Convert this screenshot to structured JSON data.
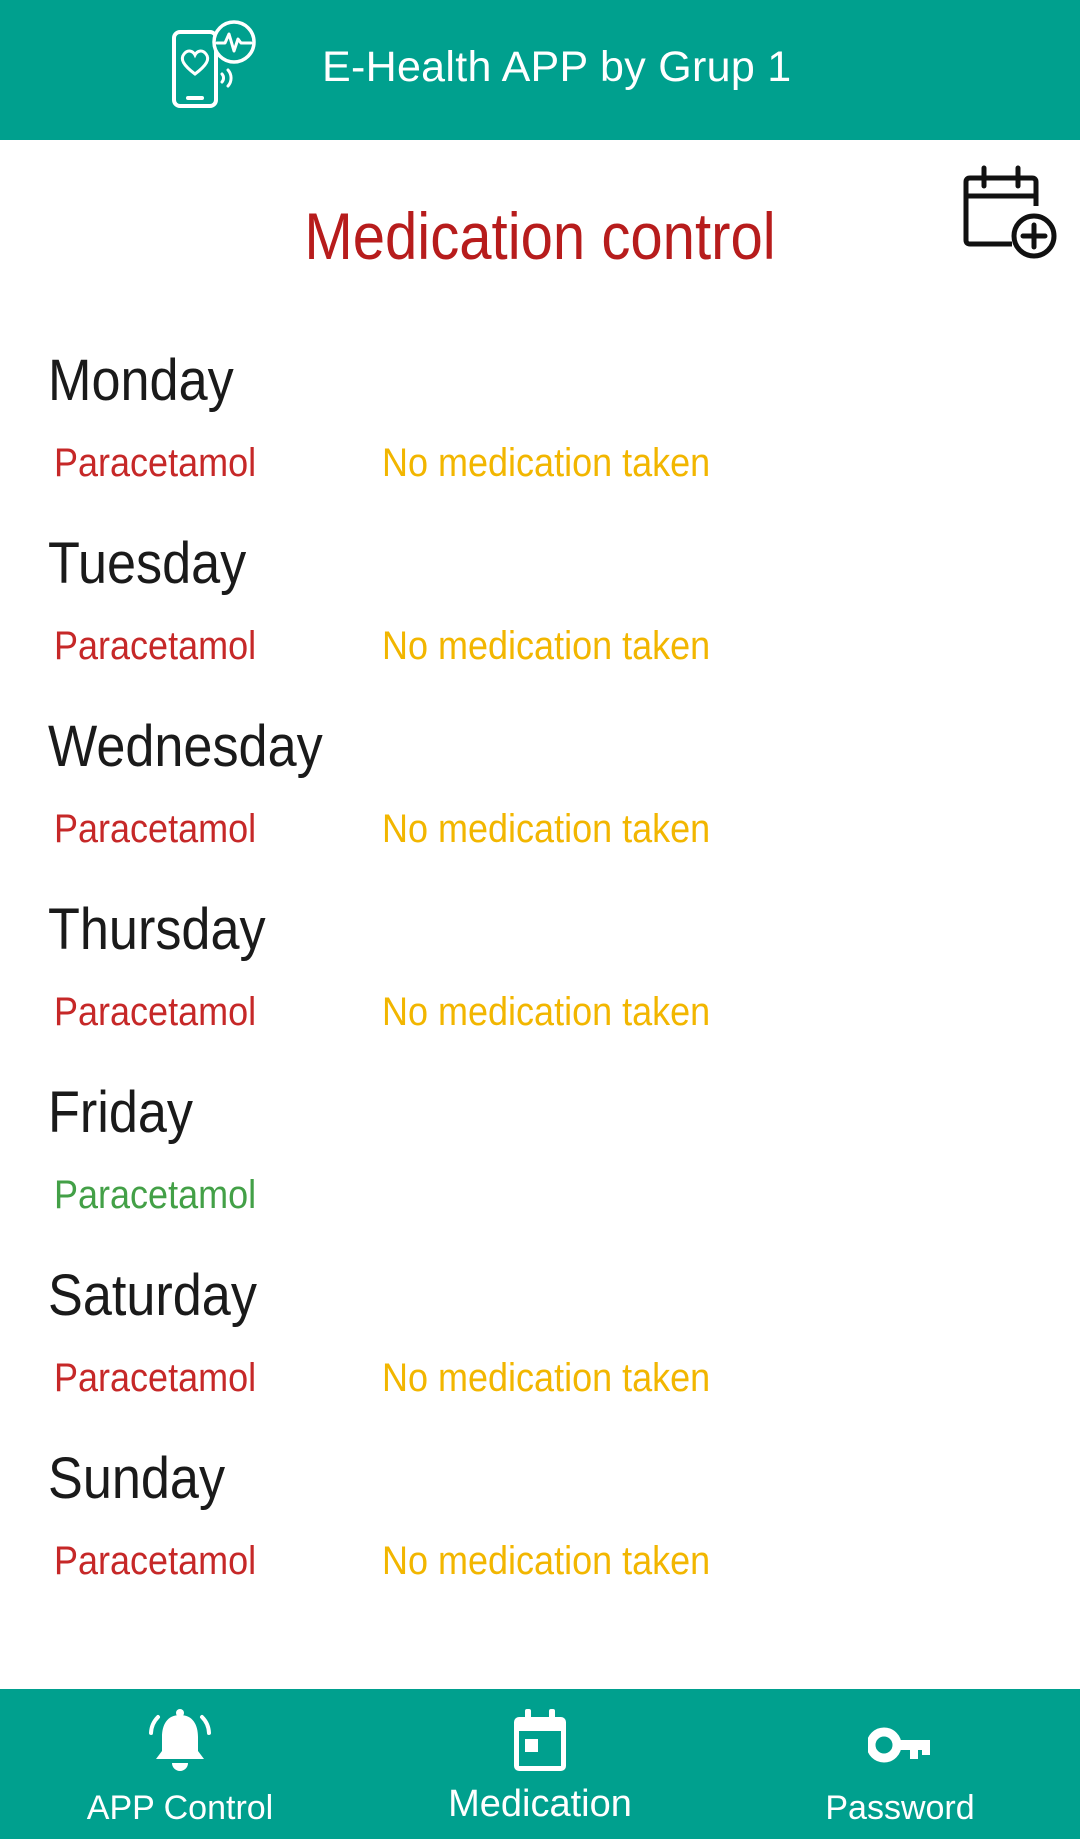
{
  "app_bar": {
    "title": "E-Health APP by Grup 1",
    "background": "#00a08e",
    "logo_icon": "phone-heart-pulse-icon"
  },
  "page": {
    "title": "Medication control",
    "title_color": "#b71c1c",
    "add_icon": "calendar-add-icon"
  },
  "days": [
    {
      "day": "Monday",
      "medication": "Paracetamol",
      "status": "No medication taken",
      "medication_color": "#c62828",
      "status_color": "#f2b600"
    },
    {
      "day": "Tuesday",
      "medication": "Paracetamol",
      "status": "No medication taken",
      "medication_color": "#c62828",
      "status_color": "#f2b600"
    },
    {
      "day": "Wednesday",
      "medication": "Paracetamol",
      "status": "No medication taken",
      "medication_color": "#c62828",
      "status_color": "#f2b600"
    },
    {
      "day": "Thursday",
      "medication": "Paracetamol",
      "status": "No medication taken",
      "medication_color": "#c62828",
      "status_color": "#f2b600"
    },
    {
      "day": "Friday",
      "medication": "Paracetamol",
      "status": "",
      "medication_color": "#43a047",
      "status_color": "#f2b600"
    },
    {
      "day": "Saturday",
      "medication": "Paracetamol",
      "status": "No medication taken",
      "medication_color": "#c62828",
      "status_color": "#f2b600"
    },
    {
      "day": "Sunday",
      "medication": "Paracetamol",
      "status": "No medication taken",
      "medication_color": "#c62828",
      "status_color": "#f2b600"
    }
  ],
  "bottom_nav": {
    "background": "#00a08e",
    "items": [
      {
        "label": "APP Control",
        "icon": "bell-ringing-icon",
        "selected": false
      },
      {
        "label": "Medication",
        "icon": "calendar-day-icon",
        "selected": true
      },
      {
        "label": "Password",
        "icon": "key-icon",
        "selected": false
      }
    ]
  }
}
